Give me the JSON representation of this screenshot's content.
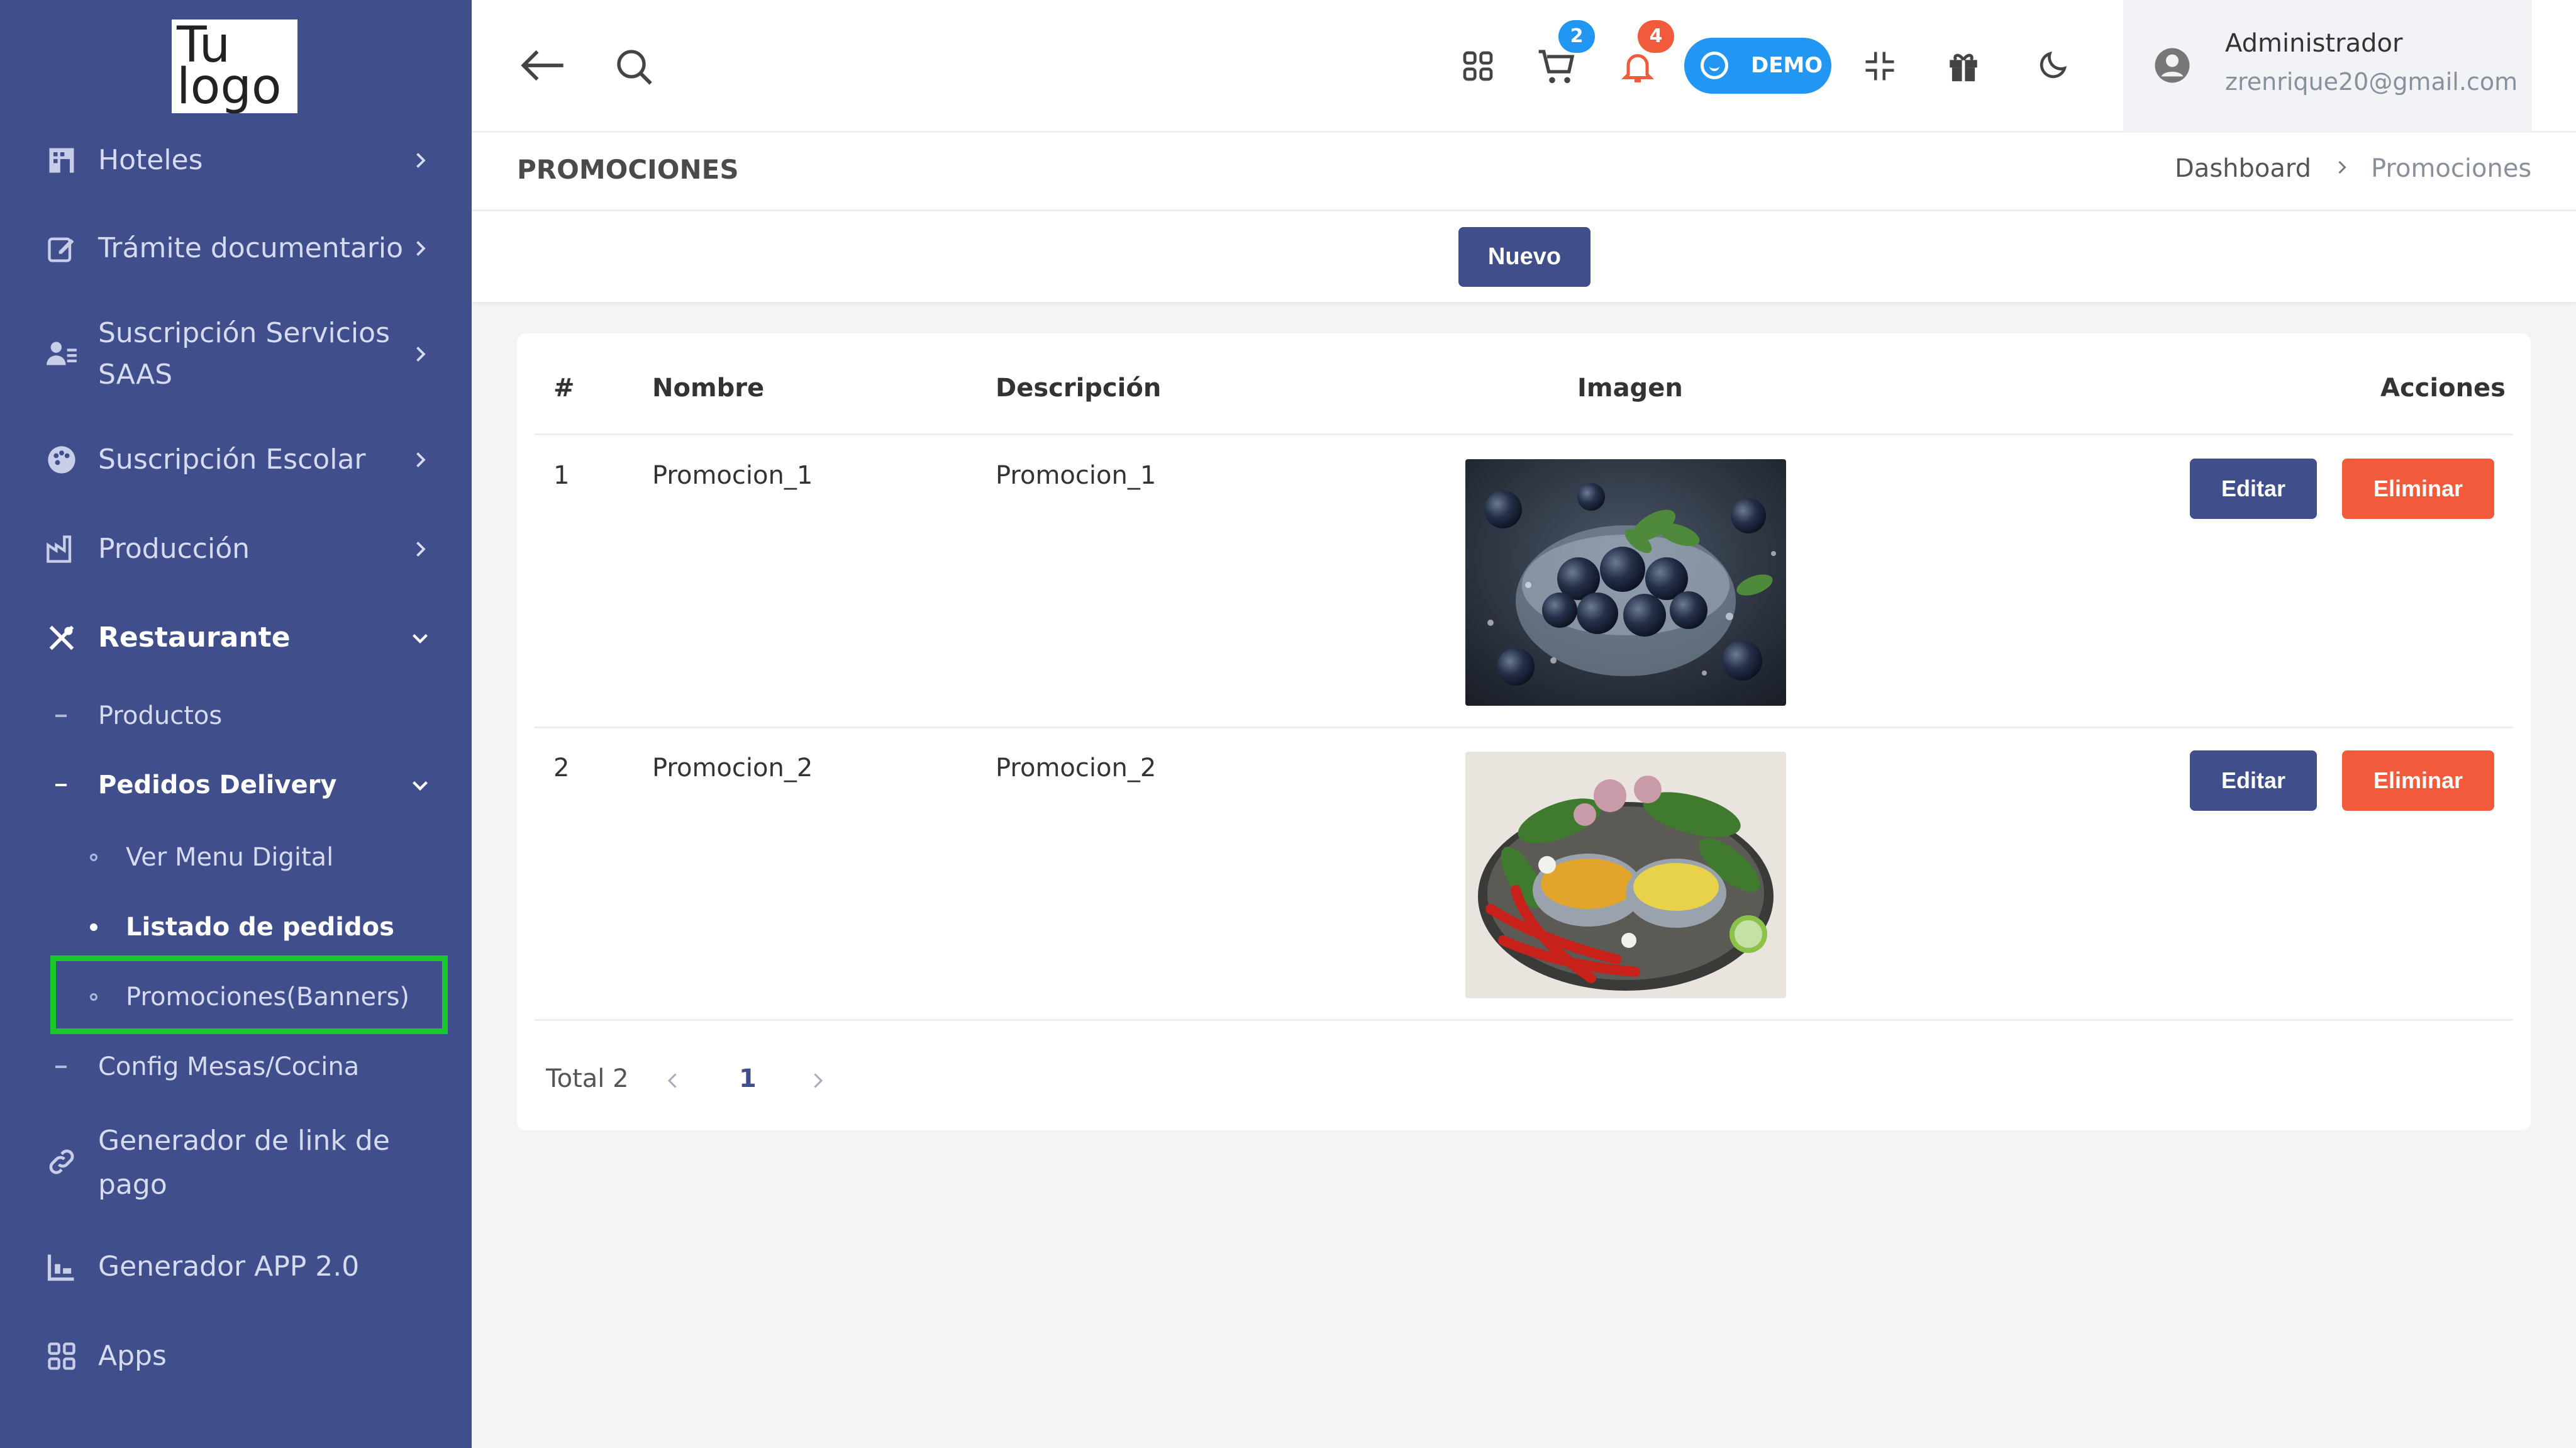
{
  "sidebar": {
    "logo": {
      "line1": "Tu",
      "line2": "logo"
    },
    "items": [
      {
        "label": "Hoteles",
        "icon": "hotel-icon"
      },
      {
        "label": "Trámite documentario",
        "icon": "document-edit-icon"
      },
      {
        "label_line1": "Suscripción Servicios",
        "label_line2": "SAAS",
        "icon": "user-list-icon"
      },
      {
        "label": "Suscripción Escolar",
        "icon": "palette-icon"
      },
      {
        "label": "Producción",
        "icon": "factory-icon"
      },
      {
        "label": "Restaurante",
        "icon": "utensils-icon",
        "expanded": true
      },
      {
        "label_line1": "Generador de link de",
        "label_line2": "pago",
        "icon": "link-icon"
      },
      {
        "label": "Generador APP 2.0",
        "icon": "app-builder-icon"
      },
      {
        "label": "Apps",
        "icon": "apps-grid-icon"
      }
    ],
    "restaurante_children": [
      {
        "label": "Productos"
      },
      {
        "label": "Pedidos Delivery",
        "expanded": true
      },
      {
        "label": "Config Mesas/Cocina"
      }
    ],
    "pedidos_children": [
      {
        "label": "Ver Menu Digital"
      },
      {
        "label": "Listado de pedidos"
      },
      {
        "label": "Promociones(Banners)",
        "highlighted": true
      }
    ]
  },
  "topbar": {
    "cart_count": "2",
    "notification_count": "4",
    "demo_label": "DEMO",
    "user_name": "Administrador",
    "user_email": "zrenrique20@gmail.com"
  },
  "page": {
    "title": "PROMOCIONES",
    "breadcrumb": [
      "Dashboard",
      "Promociones"
    ],
    "new_button": "Nuevo"
  },
  "table": {
    "columns": [
      "#",
      "Nombre",
      "Descripción",
      "Imagen",
      "Acciones"
    ],
    "rows": [
      {
        "num": "1",
        "nombre": "Promocion_1",
        "descripcion": "Promocion_1",
        "image": "blueberries-photo"
      },
      {
        "num": "2",
        "nombre": "Promocion_2",
        "descripcion": "Promocion_2",
        "image": "spices-vegetables-photo"
      }
    ],
    "edit_label": "Editar",
    "delete_label": "Eliminar"
  },
  "pagination": {
    "total_label": "Total 2",
    "current_page": "1"
  },
  "colors": {
    "sidebar_bg": "#404e8c",
    "primary": "#404e8c",
    "danger": "#f25a3c",
    "info": "#2196f3",
    "highlight": "#19c82a"
  }
}
